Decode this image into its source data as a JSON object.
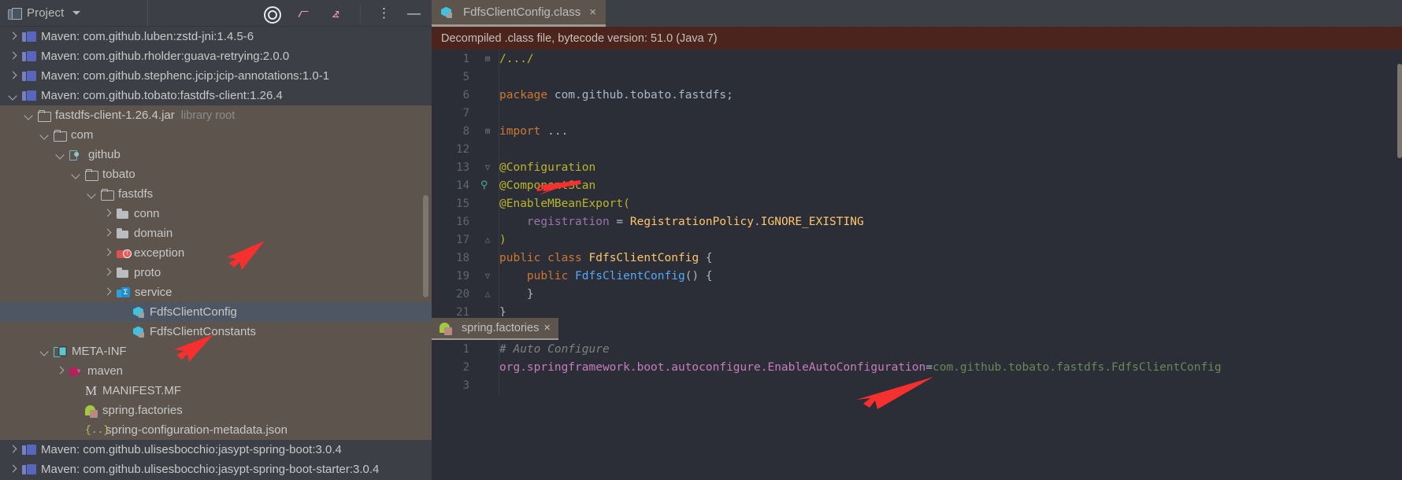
{
  "project_panel": {
    "title": "Project",
    "toolbar_icons": [
      "locate-icon",
      "expand-all-icon",
      "collapse-all-icon",
      "more-options-icon",
      "minimize-icon"
    ],
    "tree": [
      {
        "depth": 0,
        "arrow": "right",
        "icon": "library-icon",
        "label": "Maven: com.github.luben:zstd-jni:1.4.5-6",
        "state": "normal"
      },
      {
        "depth": 0,
        "arrow": "right",
        "icon": "library-icon",
        "label": "Maven: com.github.rholder:guava-retrying:2.0.0",
        "state": "normal"
      },
      {
        "depth": 0,
        "arrow": "right",
        "icon": "library-icon",
        "label": "Maven: com.github.stephenc.jcip:jcip-annotations:1.0-1",
        "state": "normal"
      },
      {
        "depth": 0,
        "arrow": "down",
        "icon": "library-icon",
        "label": "Maven: com.github.tobato:fastdfs-client:1.26.4",
        "state": "normal"
      },
      {
        "depth": 1,
        "arrow": "down",
        "icon": "folder-outline-icon",
        "label": "fastdfs-client-1.26.4.jar",
        "suffix": "library root",
        "state": "jar"
      },
      {
        "depth": 2,
        "arrow": "down",
        "icon": "folder-outline-icon",
        "label": "com",
        "state": "jar"
      },
      {
        "depth": 3,
        "arrow": "down",
        "icon": "github-folder-icon",
        "label": "github",
        "state": "jar"
      },
      {
        "depth": 4,
        "arrow": "down",
        "icon": "folder-outline-icon",
        "label": "tobato",
        "state": "jar"
      },
      {
        "depth": 5,
        "arrow": "down",
        "icon": "folder-outline-icon",
        "label": "fastdfs",
        "state": "jar"
      },
      {
        "depth": 6,
        "arrow": "right",
        "icon": "folder-grey-icon",
        "label": "conn",
        "state": "jar"
      },
      {
        "depth": 6,
        "arrow": "right",
        "icon": "folder-grey-icon",
        "label": "domain",
        "state": "jar"
      },
      {
        "depth": 6,
        "arrow": "right",
        "icon": "folder-error-icon",
        "label": "exception",
        "state": "jar"
      },
      {
        "depth": 6,
        "arrow": "right",
        "icon": "folder-grey-icon",
        "label": "proto",
        "state": "jar"
      },
      {
        "depth": 6,
        "arrow": "right",
        "icon": "folder-service-icon",
        "label": "service",
        "state": "jar"
      },
      {
        "depth": 7,
        "arrow": "blank",
        "icon": "class-icon",
        "label": "FdfsClientConfig",
        "state": "selected"
      },
      {
        "depth": 7,
        "arrow": "blank",
        "icon": "class-icon",
        "label": "FdfsClientConstants",
        "state": "jar"
      },
      {
        "depth": 2,
        "arrow": "down",
        "icon": "meta-inf-icon",
        "label": "META-INF",
        "state": "jar"
      },
      {
        "depth": 3,
        "arrow": "right",
        "icon": "maven-folder-icon",
        "label": "maven",
        "state": "jar"
      },
      {
        "depth": 4,
        "arrow": "blank",
        "icon": "manifest-icon",
        "label": "MANIFEST.MF",
        "state": "jar"
      },
      {
        "depth": 4,
        "arrow": "blank",
        "icon": "spring-icon",
        "label": "spring.factories",
        "state": "jar"
      },
      {
        "depth": 4,
        "arrow": "blank",
        "icon": "json-icon",
        "label": "spring-configuration-metadata.json",
        "state": "jar"
      },
      {
        "depth": 0,
        "arrow": "right",
        "icon": "library-icon",
        "label": "Maven: com.github.ulisesbocchio:jasypt-spring-boot:3.0.4",
        "state": "normal"
      },
      {
        "depth": 0,
        "arrow": "right",
        "icon": "library-icon",
        "label": "Maven: com.github.ulisesbocchio:jasypt-spring-boot-starter:3.0.4",
        "state": "normal"
      }
    ]
  },
  "editor": {
    "tabs": [
      {
        "label": "FdfsClientConfig.class",
        "icon": "class-icon",
        "close": "×",
        "active": true
      }
    ],
    "banner": "Decompiled .class file, bytecode version: 51.0 (Java 7)",
    "lines": [
      {
        "num": "1",
        "fold": "+",
        "segments": [
          {
            "t": "/.../",
            "c": "c-yellow"
          }
        ]
      },
      {
        "num": "5",
        "fold": "",
        "segments": []
      },
      {
        "num": "6",
        "fold": "",
        "segments": [
          {
            "t": "package ",
            "c": "c-kw"
          },
          {
            "t": "com.github.tobato.fastdfs",
            "c": "c-plain"
          },
          {
            "t": ";",
            "c": "c-plain"
          }
        ]
      },
      {
        "num": "7",
        "fold": "",
        "segments": []
      },
      {
        "num": "8",
        "fold": "+",
        "segments": [
          {
            "t": "import ",
            "c": "c-kw"
          },
          {
            "t": "...",
            "c": "c-plain"
          }
        ]
      },
      {
        "num": "12",
        "fold": "",
        "segments": []
      },
      {
        "num": "13",
        "fold": "v",
        "segments": [
          {
            "t": "@Configuration",
            "c": "c-anno"
          }
        ]
      },
      {
        "num": "14",
        "fold": "",
        "marker": "search-icon",
        "segments": [
          {
            "t": "@ComponentScan",
            "c": "c-anno"
          }
        ]
      },
      {
        "num": "15",
        "fold": "",
        "segments": [
          {
            "t": "@EnableMBeanExport(",
            "c": "c-anno"
          }
        ]
      },
      {
        "num": "16",
        "fold": "",
        "segments": [
          {
            "t": "    registration ",
            "c": "c-ident"
          },
          {
            "t": "= ",
            "c": "c-plain"
          },
          {
            "t": "RegistrationPolicy",
            "c": "c-type"
          },
          {
            "t": ".",
            "c": "c-plain"
          },
          {
            "t": "IGNORE_EXISTING",
            "c": "c-type"
          }
        ]
      },
      {
        "num": "17",
        "fold": "^",
        "segments": [
          {
            "t": ")",
            "c": "c-anno"
          }
        ]
      },
      {
        "num": "18",
        "fold": "",
        "segments": [
          {
            "t": "public class ",
            "c": "c-kw"
          },
          {
            "t": "FdfsClientConfig ",
            "c": "c-type"
          },
          {
            "t": "{",
            "c": "c-plain"
          }
        ]
      },
      {
        "num": "19",
        "fold": "v",
        "segments": [
          {
            "t": "    public ",
            "c": "c-kw"
          },
          {
            "t": "FdfsClientConfig",
            "c": "c-blue"
          },
          {
            "t": "() {",
            "c": "c-plain"
          }
        ]
      },
      {
        "num": "20",
        "fold": "^",
        "segments": [
          {
            "t": "    }",
            "c": "c-plain"
          }
        ]
      },
      {
        "num": "21",
        "fold": "",
        "segments": [
          {
            "t": "}",
            "c": "c-plain"
          }
        ]
      }
    ]
  },
  "bottom_editor": {
    "tabs": [
      {
        "label": "spring.factories",
        "icon": "spring-icon",
        "close": "×",
        "active": true
      }
    ],
    "lines": [
      {
        "num": "1",
        "segments": [
          {
            "t": "# Auto Configure",
            "c": "c-comment"
          }
        ]
      },
      {
        "num": "2",
        "segments": [
          {
            "t": "org.springframework.boot.autoconfigure.EnableAutoConfiguration",
            "c": "c-pink"
          },
          {
            "t": "=",
            "c": "c-plain"
          },
          {
            "t": "com.github.tobato.fastdfs.FdfsClientConfig",
            "c": "c-green"
          }
        ]
      },
      {
        "num": "3",
        "segments": []
      }
    ]
  },
  "annotations": {
    "color": "#f62f2f",
    "arrows": [
      "arrow-to-service",
      "arrow-to-componentscan",
      "arrow-to-manifest",
      "arrow-to-line3"
    ]
  },
  "colors": {
    "panel_bg": "#3c3f45",
    "jar_bg": "#5c544d",
    "selection": "#4e5664",
    "editor_bg": "#2b2e37",
    "banner_bg": "#4a241d",
    "accent_red": "#f62f2f"
  }
}
